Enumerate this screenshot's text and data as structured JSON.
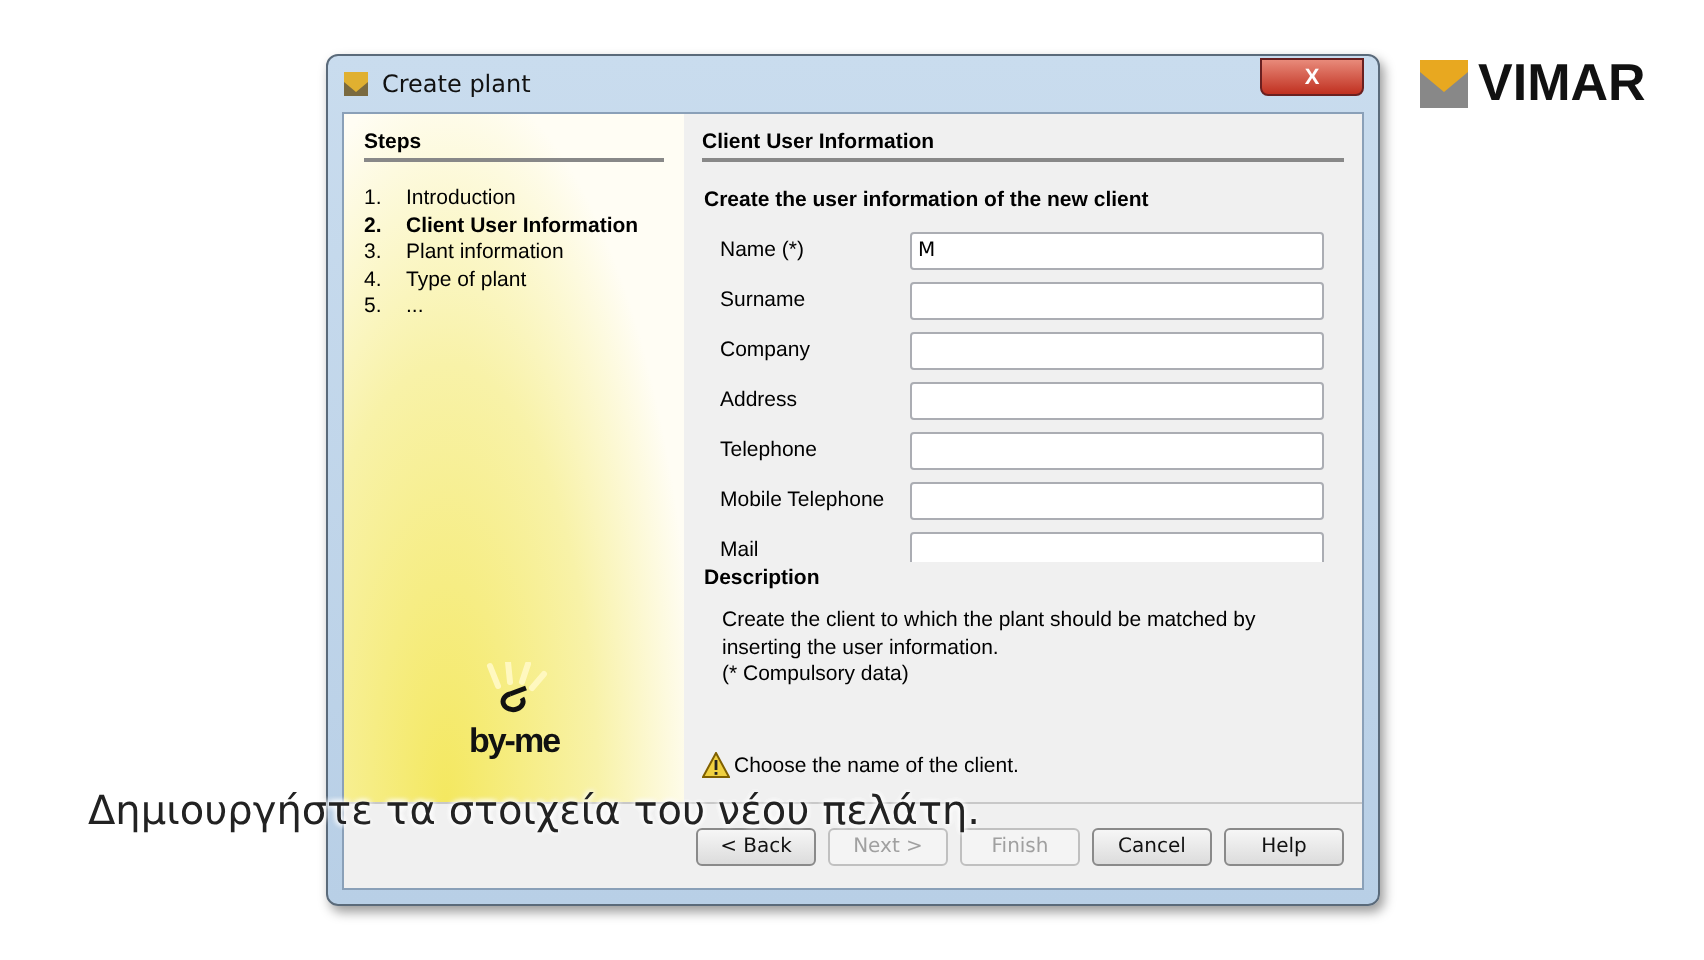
{
  "window": {
    "title": "Create plant",
    "close": "X"
  },
  "steps": {
    "title": "Steps",
    "items": [
      {
        "number": "1.",
        "label": "Introduction",
        "selected": false
      },
      {
        "number": "2.",
        "label": "Client User Information",
        "selected": true
      },
      {
        "number": "3.",
        "label": "Plant information",
        "selected": false
      },
      {
        "number": "4.",
        "label": "Type of plant",
        "selected": false
      },
      {
        "number": "5.",
        "label": "...",
        "selected": false
      }
    ],
    "logo": "by-me"
  },
  "panel": {
    "title": "Client User Information",
    "subtitle": "Create the user information of the new client",
    "fields": [
      {
        "label": "Name (*)",
        "value": "M"
      },
      {
        "label": "Surname"
      },
      {
        "label": "Company"
      },
      {
        "label": "Address"
      },
      {
        "label": "Telephone"
      },
      {
        "label": "Mobile Telephone"
      },
      {
        "label": "Mail"
      }
    ],
    "description_title": "Description",
    "description": [
      "Create the client to which the plant should be matched by inserting the user information.",
      "(* Compulsory data)"
    ],
    "warning": "Choose the name of the client."
  },
  "buttons": [
    {
      "label": "< Back",
      "disabled": false
    },
    {
      "label": "Next >",
      "disabled": true
    },
    {
      "label": "Finish",
      "disabled": true
    },
    {
      "label": "Cancel",
      "disabled": false
    },
    {
      "label": "Help",
      "disabled": false
    }
  ],
  "brand": "VIMAR",
  "subtitle": "Δημιουργήστε τα στοιχεία του νέου πελάτη."
}
